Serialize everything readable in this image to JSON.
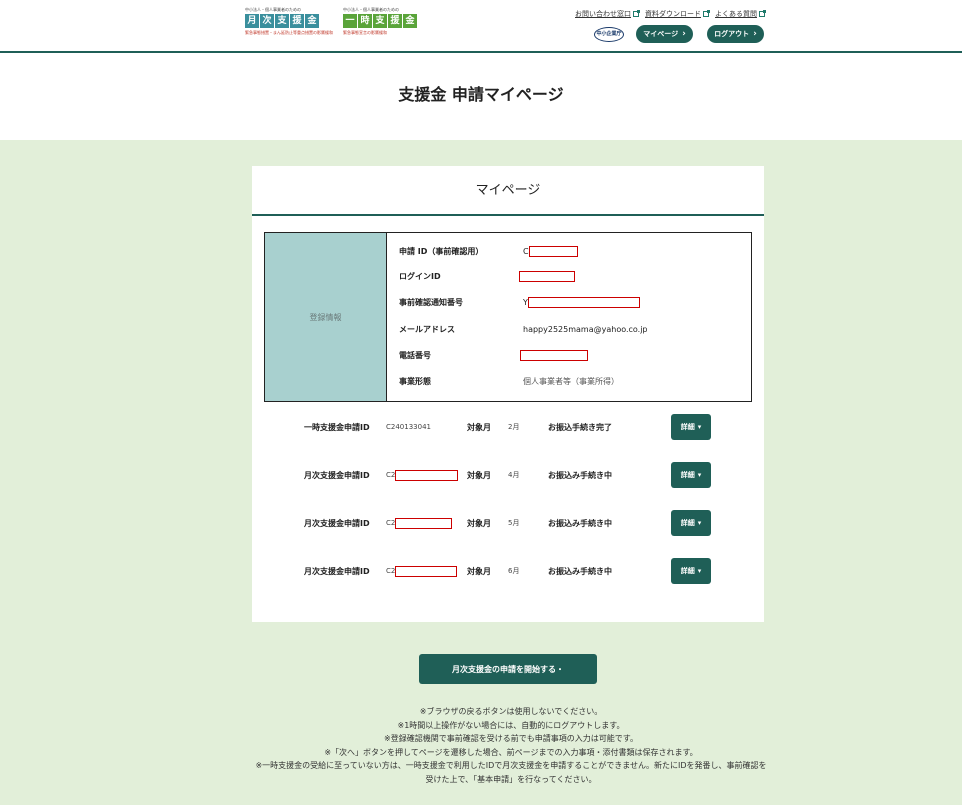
{
  "header": {
    "logo1": {
      "subtitle": "中小法人・個人事業者のための",
      "chars": [
        "月",
        "次",
        "支",
        "援",
        "金"
      ],
      "footer": "緊急事態措置・まん延防止等重点措置の影響緩和"
    },
    "logo2": {
      "subtitle": "中小法人・個人事業者のための",
      "chars": [
        "一",
        "時",
        "支",
        "援",
        "金"
      ],
      "footer": "緊急事態宣言の影響緩和"
    },
    "links": [
      {
        "label": "お問い合わせ窓口"
      },
      {
        "label": "資料ダウンロード"
      },
      {
        "label": "よくある質問"
      }
    ],
    "badge": "中小企業庁",
    "mypage_label": "マイページ",
    "logout_label": "ログアウト"
  },
  "page_title": "支援金 申請マイページ",
  "card": {
    "title": "マイページ",
    "info_label": "登録情報",
    "info": [
      {
        "key": "申請 ID（事前確認用）",
        "value": "C"
      },
      {
        "key": "ログインID",
        "value": ""
      },
      {
        "key": "事前確認通知番号",
        "value": "Y"
      },
      {
        "key": "メールアドレス",
        "value": "happy2525mama@yahoo.co.jp"
      },
      {
        "key": "電話番号",
        "value": ""
      },
      {
        "key": "事業形態",
        "value": "個人事業者等（事業所得）"
      }
    ],
    "applications": [
      {
        "label": "一時支援金申請ID",
        "id": "C240133041",
        "target_label": "対象月",
        "month": "2月",
        "status": "お振込手続き完了",
        "detail": "詳細"
      },
      {
        "label": "月次支援金申請ID",
        "id": "C2",
        "target_label": "対象月",
        "month": "4月",
        "status": "お振込み手続き中",
        "detail": "詳細"
      },
      {
        "label": "月次支援金申請ID",
        "id": "C2",
        "target_label": "対象月",
        "month": "5月",
        "status": "お振込み手続き中",
        "detail": "詳細"
      },
      {
        "label": "月次支援金申請ID",
        "id": "C2",
        "target_label": "対象月",
        "month": "6月",
        "status": "お振込み手続き中",
        "detail": "詳細"
      }
    ]
  },
  "start_button": "月次支援金の申請を開始する・",
  "notes": [
    "※ブラウザの戻るボタンは使用しないでください。",
    "※1時間以上操作がない場合には、自動的にログアウトします。",
    "※登録確認機関で事前確認を受ける前でも申請事項の入力は可能です。",
    "※「次へ」ボタンを押してページを遷移した場合、前ページまでの入力事項・添付書類は保存されます。",
    "※一時支援金の受給に至っていない方は、一時支援金で利用したIDで月次支援金を申請することができません。新たにIDを発番し、事前確認を受けた上で、「基本申請」を行なってください。"
  ],
  "colors": {
    "primary": "#1f5f57",
    "background": "#e2efd9",
    "info_label_bg": "#a8d0cf"
  }
}
